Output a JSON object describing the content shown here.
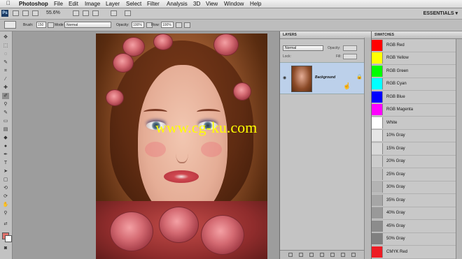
{
  "menubar": {
    "app_name": "Photoshop",
    "items": [
      "File",
      "Edit",
      "Image",
      "Layer",
      "Select",
      "Filter",
      "Analysis",
      "3D",
      "View",
      "Window",
      "Help"
    ]
  },
  "appbar": {
    "zoom": "55.6%",
    "workspace": "ESSENTIALS ▾"
  },
  "options": {
    "brush_label": "Brush:",
    "brush_size": "150",
    "mode_label": "Mode:",
    "mode_value": "Normal",
    "opacity_label": "Opacity:",
    "opacity_value": "100%",
    "flow_label": "Flow:",
    "flow_value": "100%"
  },
  "canvas": {
    "watermark": "www.cg-ku.com"
  },
  "layers_panel": {
    "title": "LAYERS",
    "blend_mode": "Normal",
    "opacity_label": "Opacity:",
    "lock_label": "Lock:",
    "fill_label": "Fill:",
    "layer_name": "Background"
  },
  "swatches_panel": {
    "title": "SWATCHES",
    "items": [
      {
        "name": "RGB Red",
        "color": "#ff0000"
      },
      {
        "name": "RGB Yellow",
        "color": "#ffff00"
      },
      {
        "name": "RGB Green",
        "color": "#00ff00"
      },
      {
        "name": "RGB Cyan",
        "color": "#00ffff"
      },
      {
        "name": "RGB Blue",
        "color": "#0000ff"
      },
      {
        "name": "RGB Magenta",
        "color": "#ff00ff"
      },
      {
        "name": "White",
        "color": "#ffffff"
      },
      {
        "name": "10% Gray",
        "color": "#e6e6e6"
      },
      {
        "name": "15% Gray",
        "color": "#d9d9d9"
      },
      {
        "name": "20% Gray",
        "color": "#cccccc"
      },
      {
        "name": "25% Gray",
        "color": "#bfbfbf"
      },
      {
        "name": "30% Gray",
        "color": "#b3b3b3"
      },
      {
        "name": "35% Gray",
        "color": "#a6a6a6"
      },
      {
        "name": "40% Gray",
        "color": "#999999"
      },
      {
        "name": "45% Gray",
        "color": "#8c8c8c"
      },
      {
        "name": "50% Gray",
        "color": "#808080"
      },
      {
        "name": "CMYK Red",
        "color": "#ed1c24"
      }
    ]
  },
  "colors": {
    "foreground": "#e0726c",
    "background": "#ffffff",
    "layer_selected": "#bcd0ea"
  }
}
